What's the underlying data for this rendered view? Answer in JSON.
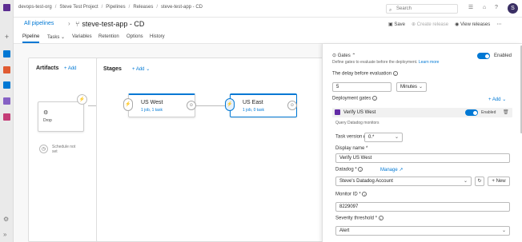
{
  "colors": {
    "accent": "#0078d4",
    "avatar_bg": "#3a2f64"
  },
  "rail": {
    "icons": [
      {
        "name": "azure-devops-icon",
        "color": "#5c2d91"
      },
      {
        "name": "boards-icon",
        "color": "#0078d4"
      },
      {
        "name": "repos-icon",
        "color": "#e05b32"
      },
      {
        "name": "pipelines-icon",
        "color": "#0078d4"
      },
      {
        "name": "test-plans-icon",
        "color": "#8661c5"
      },
      {
        "name": "artifacts-icon",
        "color": "#c43d77"
      }
    ]
  },
  "breadcrumb": {
    "items": [
      "devops-test-org",
      "Steve Test Project",
      "Pipelines",
      "Releases",
      "steve-test-app - CD"
    ],
    "separator": "/"
  },
  "search": {
    "placeholder": "Search"
  },
  "user": {
    "initial": "S"
  },
  "header": {
    "all_pipelines": "All pipelines",
    "separator": "›",
    "title": "steve-test-app - CD",
    "save": "Save",
    "create_release": "Create release",
    "view_releases": "View releases",
    "more": "⋯"
  },
  "tabs": [
    {
      "label": "Pipeline",
      "active": true
    },
    {
      "label": "Tasks",
      "caret": true
    },
    {
      "label": "Variables"
    },
    {
      "label": "Retention"
    },
    {
      "label": "Options"
    },
    {
      "label": "History"
    }
  ],
  "pipeline": {
    "artifacts_title": "Artifacts",
    "stages_title": "Stages",
    "add_label": "Add",
    "artifact": {
      "name": "Drop"
    },
    "schedule": "Schedule not set",
    "stages": [
      {
        "name": "US West",
        "summary": "1 job, 1 task"
      },
      {
        "name": "US East",
        "summary": "1 job, 0 task"
      }
    ]
  },
  "gates": {
    "title": "Gates",
    "description": "Define gates to evaluate before the deployment.",
    "learn_more": "Learn more",
    "enabled_label": "Enabled",
    "delay_label": "The delay before evaluation",
    "delay_value": "5",
    "delay_unit": "Minutes",
    "deployment_gates_label": "Deployment gates",
    "add_label": "Add",
    "gate": {
      "name": "Verify US West",
      "enabled_label": "Enabled",
      "subtitle": "Query Datadog monitors",
      "task_version_label": "Task version",
      "task_version_value": "0.*",
      "display_name_label": "Display name *",
      "display_name_value": "Verify US West",
      "datadog_label": "Datadog *",
      "manage_label": "Manage",
      "datadog_value": "Steve's Datadog Account",
      "new_label": "New",
      "monitor_label": "Monitor ID *",
      "monitor_value": "8229097",
      "severity_label": "Severity threshold *",
      "severity_value": "Alert"
    }
  }
}
